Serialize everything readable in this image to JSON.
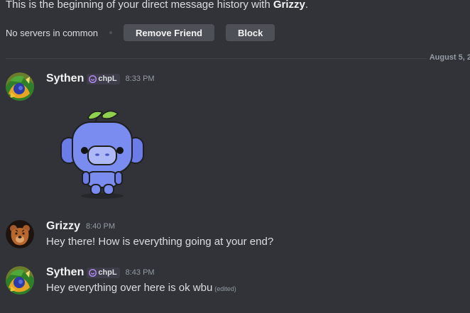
{
  "intro": {
    "prefix": "This is the beginning of your direct message history with ",
    "username": "Grizzy",
    "suffix": "."
  },
  "profile_actions": {
    "mutual": "No servers in common",
    "remove_label": "Remove Friend",
    "block_label": "Block"
  },
  "divider": {
    "date": "August 5, 2"
  },
  "messages": [
    {
      "author": "Sythen",
      "tag": "chpL",
      "time": "8:33 PM",
      "content": "",
      "sticker": "wumpus-sticker"
    },
    {
      "author": "Grizzy",
      "time": "8:40 PM",
      "content": "Hey there! How is everything going at your end?"
    },
    {
      "author": "Sythen",
      "tag": "chpL",
      "time": "8:43 PM",
      "content": "Hey everything over here is ok wbu",
      "edited": "(edited)"
    }
  ],
  "colors": {
    "background": "#313338",
    "button": "#4e5058",
    "muted_text": "#949ba4",
    "primary_text": "#dbdee1",
    "tag_icon": "#b38ef7"
  }
}
